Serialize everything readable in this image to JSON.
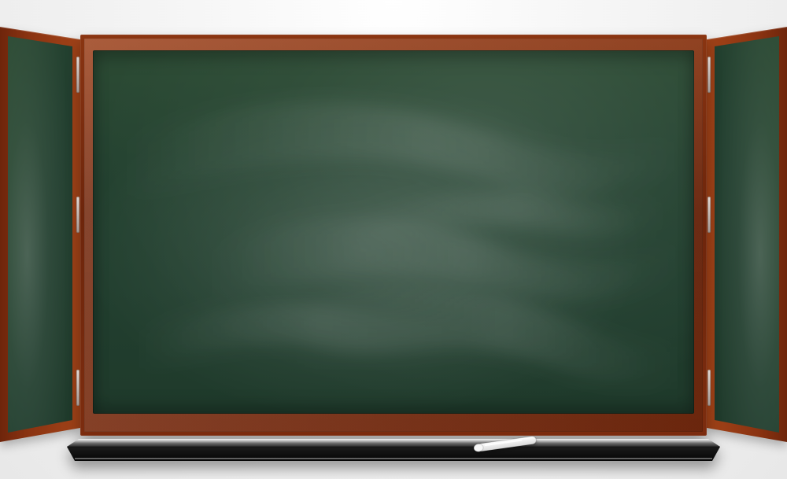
{
  "scene": {
    "name": "chalkboard-illustration",
    "colors": {
      "background": "#efefef",
      "wood_dark": "#7a2a0d",
      "wood_light": "#9a3b14",
      "board_green": "#223f2f",
      "tray_black": "#0d0d0d",
      "tray_metal": "#cfcfcf",
      "chalk_white": "#f7f7f7"
    }
  }
}
